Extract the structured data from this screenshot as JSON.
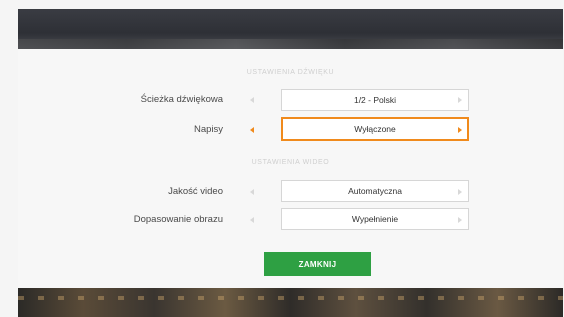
{
  "dialog": {
    "section_audio": "USTAWIENIA DŹWIĘKU",
    "section_video": "USTAWIENIA WIDEO",
    "rows": [
      {
        "label": "Ścieżka dźwiękowa",
        "value": "1/2 - Polski"
      },
      {
        "label": "Napisy",
        "value": "Wyłączone"
      },
      {
        "label": "Jakość video",
        "value": "Automatyczna"
      },
      {
        "label": "Dopasowanie obrazu",
        "value": "Wypełnienie"
      }
    ],
    "close_label": "ZAMKNIJ",
    "colors": {
      "accent": "#f08a1c",
      "button": "#2ea043"
    }
  }
}
